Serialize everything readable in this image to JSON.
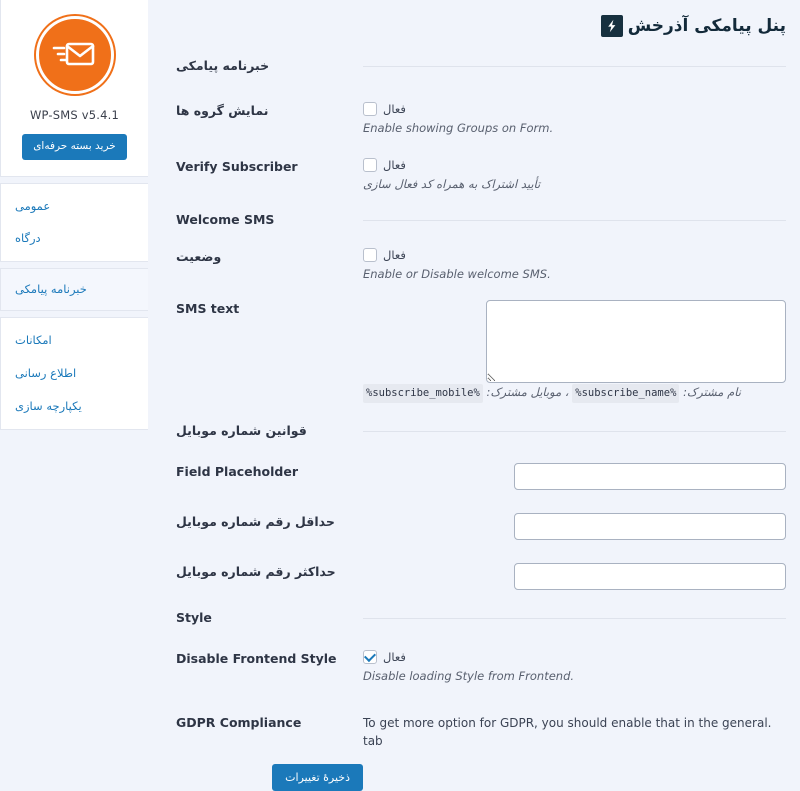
{
  "topbar": {
    "brand_text": "پنل پیامکی آذرخش",
    "brand_icon": "lightning-bolt-icon"
  },
  "sidebar": {
    "logo_icon": "envelope-send-icon",
    "version": "WP-SMS v5.4.1",
    "buy_button": "خرید بسته حرفه‌ای",
    "menu_group_1": [
      {
        "label": "عمومی",
        "active": false
      },
      {
        "label": "درگاه",
        "active": false
      }
    ],
    "menu_group_active": [
      {
        "label": "خبرنامه پیامکی",
        "active": true
      }
    ],
    "menu_group_2": [
      {
        "label": "امکانات",
        "active": false
      },
      {
        "label": "اطلاع رسانی",
        "active": false
      },
      {
        "label": "یکپارچه سازی",
        "active": false
      }
    ]
  },
  "form": {
    "section_newsletter": "خبرنامه پیامکی",
    "section_welcome": "Welcome SMS",
    "section_mobile_rules": "قوانین شماره موبایل",
    "section_style": "Style",
    "enabled_label": "فعال",
    "rows": {
      "show_groups": {
        "label": "نمایش گروه ها",
        "checked": false,
        "desc": ".Enable showing Groups on Form"
      },
      "verify_subscriber": {
        "label": "Verify Subscriber",
        "checked": false,
        "desc": "تأیید اشتراک به همراه کد فعال سازی"
      },
      "welcome_status": {
        "label": "وضعیت",
        "checked": false,
        "desc": ".Enable or Disable welcome SMS"
      },
      "sms_text": {
        "label": "SMS text",
        "value": "",
        "vars_prefix": "نام مشترک:",
        "var_name": "%subscribe_name%",
        "vars_middle": "، موبایل مشترک:",
        "var_mobile": "%subscribe_mobile%"
      },
      "field_placeholder": {
        "label": "Field Placeholder",
        "value": ""
      },
      "min_digits": {
        "label": "حداقل رقم شماره موبایل",
        "value": ""
      },
      "max_digits": {
        "label": "حداکثر رقم شماره موبایل",
        "value": ""
      },
      "disable_frontend_style": {
        "label": "Disable Frontend Style",
        "checked": true,
        "desc": ".Disable loading Style from Frontend"
      },
      "gdpr": {
        "label": "GDPR Compliance",
        "note": ".To get more option for GDPR, you should enable that in the general tab"
      }
    },
    "save_button": "ذخیرهٔ تغییرات"
  },
  "colors": {
    "accent_blue": "#1b79ba",
    "logo_orange": "#f07019",
    "page_bg": "#f1f4fb",
    "label_dark": "#2e3545"
  }
}
